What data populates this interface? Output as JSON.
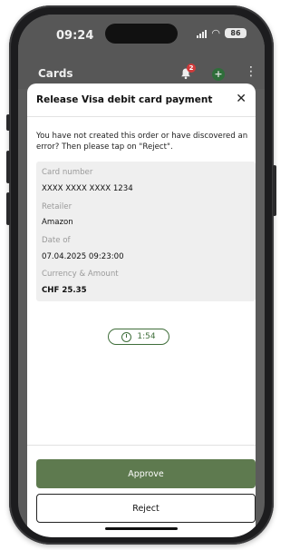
{
  "status_bar": {
    "time": "09:24",
    "battery": "86",
    "icons": [
      "signal-icon",
      "wifi-icon",
      "battery-icon"
    ]
  },
  "app_bar": {
    "title": "Cards",
    "notification_count": "2",
    "icons": [
      "bell-icon",
      "plus-icon",
      "more-icon"
    ]
  },
  "sheet": {
    "title": "Release Visa debit card payment",
    "intro": "You have not created this order or have discovered an error? Then please tap on \"Reject\".",
    "details": [
      {
        "label": "Card number",
        "value": "XXXX XXXX XXXX 1234"
      },
      {
        "label": "Retailer",
        "value": "Amazon"
      },
      {
        "label": "Date of",
        "value": "07.04.2025 09:23:00"
      },
      {
        "label": "Currency & Amount",
        "value": "CHF 25.35"
      }
    ],
    "timer": "1:54",
    "approve_label": "Approve",
    "reject_label": "Reject"
  },
  "colors": {
    "accent_green": "#5e7a4f",
    "timer_green": "#3f6e3a",
    "badge_red": "#d13a3a"
  }
}
